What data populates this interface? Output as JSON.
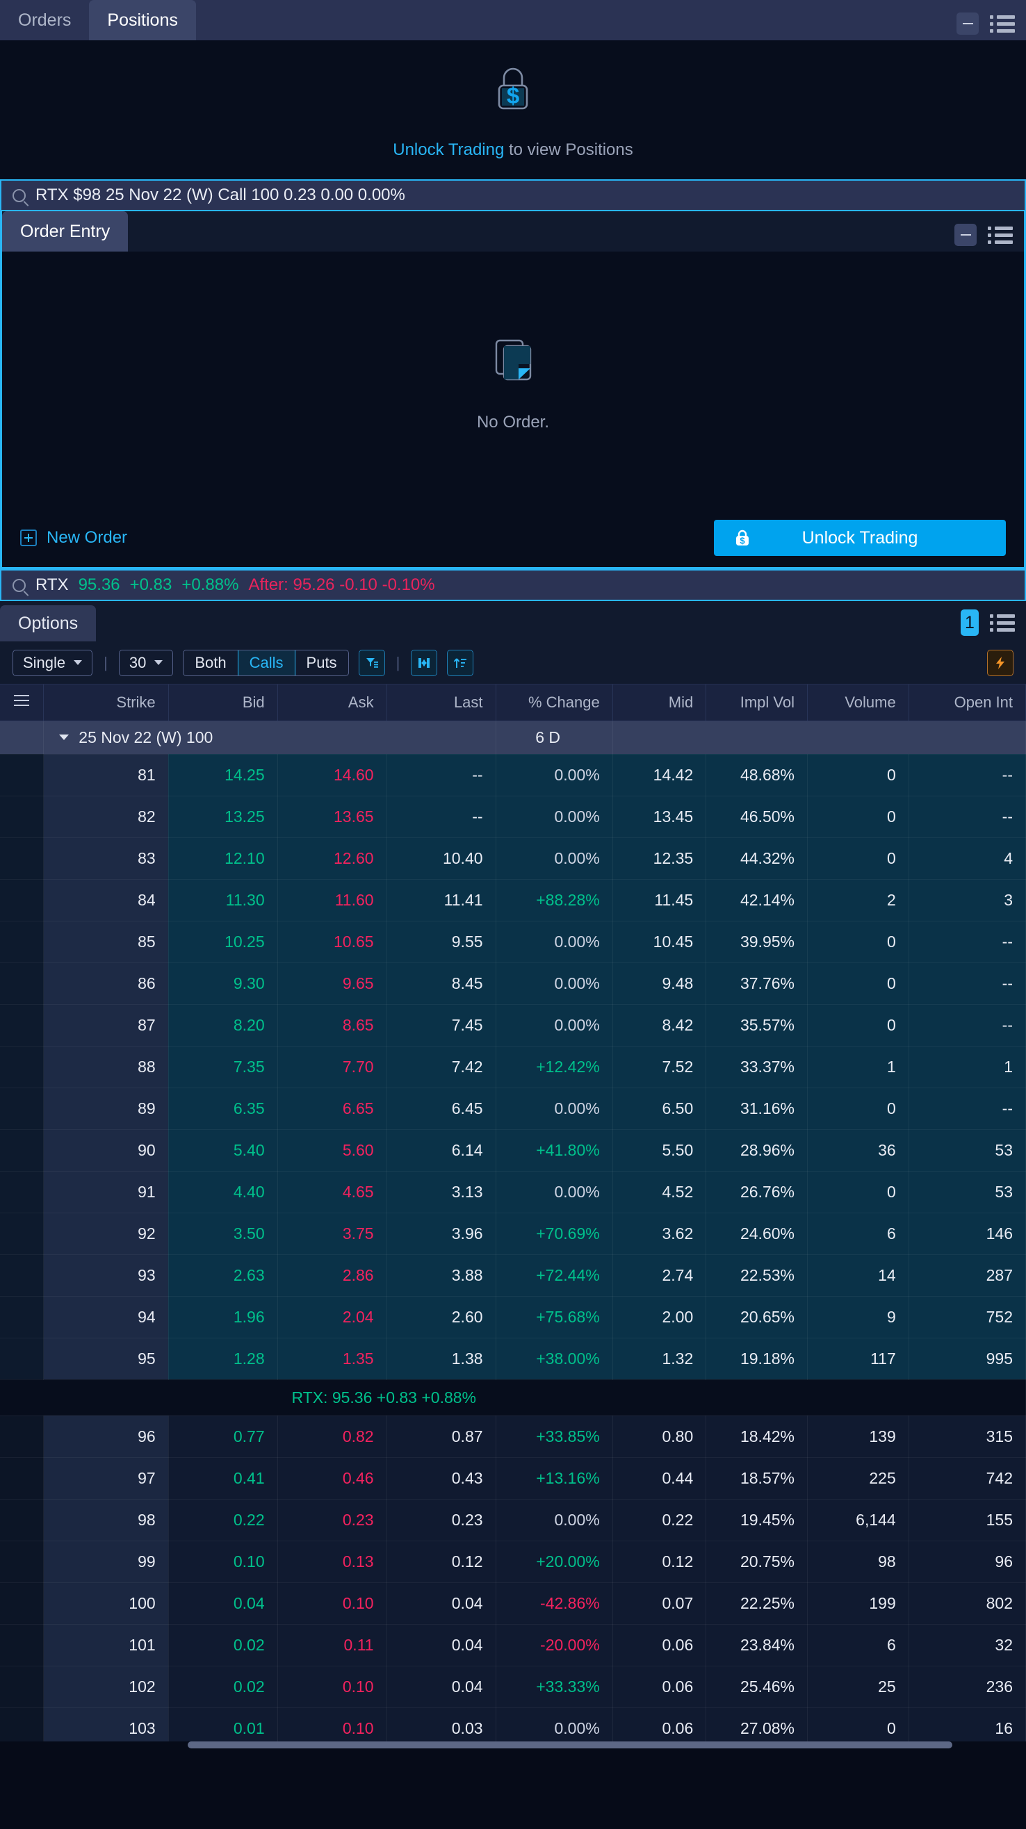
{
  "positions_panel": {
    "tabs": [
      {
        "label": "Orders",
        "active": false
      },
      {
        "label": "Positions",
        "active": true
      }
    ],
    "minimize_label": "",
    "empty": {
      "link_text": "Unlock Trading",
      "rest_text": " to view Positions",
      "icon": "lock-dollar-icon"
    }
  },
  "option_search": {
    "value": "RTX $98 25 Nov 22 (W) Call 100  0.23 0.00 0.00%",
    "icon": "search-icon"
  },
  "order_entry": {
    "tab_label": "Order Entry",
    "empty_text": "No Order.",
    "empty_icon": "documents-icon",
    "new_order_label": "New Order",
    "unlock_label": "Unlock Trading"
  },
  "quote_search": {
    "symbol": "RTX",
    "last": "95.36",
    "change": "+0.83",
    "change_pct": "+0.88%",
    "after_label": "After: 95.26 -0.10 -0.10%"
  },
  "options_panel": {
    "tab_label": "Options",
    "badge": "1",
    "toolbar": {
      "strategy": "Single",
      "count": "30",
      "side_options": [
        {
          "label": "Both",
          "active": false
        },
        {
          "label": "Calls",
          "active": true
        },
        {
          "label": "Puts",
          "active": false
        }
      ],
      "icons": [
        "filter-icon",
        "split-columns-icon",
        "sort-ascending-icon",
        "lightning-icon"
      ]
    },
    "columns": [
      "Strike",
      "Bid",
      "Ask",
      "Last",
      "% Change",
      "Mid",
      "Impl Vol",
      "Volume",
      "Open Int"
    ],
    "menu_icon": "hamburger-icon",
    "expiry_group": {
      "label": "25 Nov 22 (W) 100",
      "days": "6 D"
    },
    "underlying_marker": "RTX: 95.36 +0.83 +0.88%",
    "rows": [
      {
        "strike": "81",
        "bid": "14.25",
        "ask": "14.60",
        "last": "--",
        "change": "0.00%",
        "chg_dir": "flat",
        "mid": "14.42",
        "iv": "48.68%",
        "volume": "0",
        "oi": "--",
        "itm": true
      },
      {
        "strike": "82",
        "bid": "13.25",
        "ask": "13.65",
        "last": "--",
        "change": "0.00%",
        "chg_dir": "flat",
        "mid": "13.45",
        "iv": "46.50%",
        "volume": "0",
        "oi": "--",
        "itm": true
      },
      {
        "strike": "83",
        "bid": "12.10",
        "ask": "12.60",
        "last": "10.40",
        "change": "0.00%",
        "chg_dir": "flat",
        "mid": "12.35",
        "iv": "44.32%",
        "volume": "0",
        "oi": "4",
        "itm": true
      },
      {
        "strike": "84",
        "bid": "11.30",
        "ask": "11.60",
        "last": "11.41",
        "change": "+88.28%",
        "chg_dir": "up",
        "mid": "11.45",
        "iv": "42.14%",
        "volume": "2",
        "oi": "3",
        "itm": true
      },
      {
        "strike": "85",
        "bid": "10.25",
        "ask": "10.65",
        "last": "9.55",
        "change": "0.00%",
        "chg_dir": "flat",
        "mid": "10.45",
        "iv": "39.95%",
        "volume": "0",
        "oi": "--",
        "itm": true
      },
      {
        "strike": "86",
        "bid": "9.30",
        "ask": "9.65",
        "last": "8.45",
        "change": "0.00%",
        "chg_dir": "flat",
        "mid": "9.48",
        "iv": "37.76%",
        "volume": "0",
        "oi": "--",
        "itm": true
      },
      {
        "strike": "87",
        "bid": "8.20",
        "ask": "8.65",
        "last": "7.45",
        "change": "0.00%",
        "chg_dir": "flat",
        "mid": "8.42",
        "iv": "35.57%",
        "volume": "0",
        "oi": "--",
        "itm": true
      },
      {
        "strike": "88",
        "bid": "7.35",
        "ask": "7.70",
        "last": "7.42",
        "change": "+12.42%",
        "chg_dir": "up",
        "mid": "7.52",
        "iv": "33.37%",
        "volume": "1",
        "oi": "1",
        "itm": true
      },
      {
        "strike": "89",
        "bid": "6.35",
        "ask": "6.65",
        "last": "6.45",
        "change": "0.00%",
        "chg_dir": "flat",
        "mid": "6.50",
        "iv": "31.16%",
        "volume": "0",
        "oi": "--",
        "itm": true
      },
      {
        "strike": "90",
        "bid": "5.40",
        "ask": "5.60",
        "last": "6.14",
        "change": "+41.80%",
        "chg_dir": "up",
        "mid": "5.50",
        "iv": "28.96%",
        "volume": "36",
        "oi": "53",
        "itm": true
      },
      {
        "strike": "91",
        "bid": "4.40",
        "ask": "4.65",
        "last": "3.13",
        "change": "0.00%",
        "chg_dir": "flat",
        "mid": "4.52",
        "iv": "26.76%",
        "volume": "0",
        "oi": "53",
        "itm": true
      },
      {
        "strike": "92",
        "bid": "3.50",
        "ask": "3.75",
        "last": "3.96",
        "change": "+70.69%",
        "chg_dir": "up",
        "mid": "3.62",
        "iv": "24.60%",
        "volume": "6",
        "oi": "146",
        "itm": true
      },
      {
        "strike": "93",
        "bid": "2.63",
        "ask": "2.86",
        "last": "3.88",
        "change": "+72.44%",
        "chg_dir": "up",
        "mid": "2.74",
        "iv": "22.53%",
        "volume": "14",
        "oi": "287",
        "itm": true
      },
      {
        "strike": "94",
        "bid": "1.96",
        "ask": "2.04",
        "last": "2.60",
        "change": "+75.68%",
        "chg_dir": "up",
        "mid": "2.00",
        "iv": "20.65%",
        "volume": "9",
        "oi": "752",
        "itm": true
      },
      {
        "strike": "95",
        "bid": "1.28",
        "ask": "1.35",
        "last": "1.38",
        "change": "+38.00%",
        "chg_dir": "up",
        "mid": "1.32",
        "iv": "19.18%",
        "volume": "117",
        "oi": "995",
        "itm": true
      },
      {
        "strike": "96",
        "bid": "0.77",
        "ask": "0.82",
        "last": "0.87",
        "change": "+33.85%",
        "chg_dir": "up",
        "mid": "0.80",
        "iv": "18.42%",
        "volume": "139",
        "oi": "315",
        "itm": false
      },
      {
        "strike": "97",
        "bid": "0.41",
        "ask": "0.46",
        "last": "0.43",
        "change": "+13.16%",
        "chg_dir": "up",
        "mid": "0.44",
        "iv": "18.57%",
        "volume": "225",
        "oi": "742",
        "itm": false
      },
      {
        "strike": "98",
        "bid": "0.22",
        "ask": "0.23",
        "last": "0.23",
        "change": "0.00%",
        "chg_dir": "flat",
        "mid": "0.22",
        "iv": "19.45%",
        "volume": "6,144",
        "oi": "155",
        "itm": false
      },
      {
        "strike": "99",
        "bid": "0.10",
        "ask": "0.13",
        "last": "0.12",
        "change": "+20.00%",
        "chg_dir": "up",
        "mid": "0.12",
        "iv": "20.75%",
        "volume": "98",
        "oi": "96",
        "itm": false
      },
      {
        "strike": "100",
        "bid": "0.04",
        "ask": "0.10",
        "last": "0.04",
        "change": "-42.86%",
        "chg_dir": "down",
        "mid": "0.07",
        "iv": "22.25%",
        "volume": "199",
        "oi": "802",
        "itm": false
      },
      {
        "strike": "101",
        "bid": "0.02",
        "ask": "0.11",
        "last": "0.04",
        "change": "-20.00%",
        "chg_dir": "down",
        "mid": "0.06",
        "iv": "23.84%",
        "volume": "6",
        "oi": "32",
        "itm": false
      },
      {
        "strike": "102",
        "bid": "0.02",
        "ask": "0.10",
        "last": "0.04",
        "change": "+33.33%",
        "chg_dir": "up",
        "mid": "0.06",
        "iv": "25.46%",
        "volume": "25",
        "oi": "236",
        "itm": false
      },
      {
        "strike": "103",
        "bid": "0.01",
        "ask": "0.10",
        "last": "0.03",
        "change": "0.00%",
        "chg_dir": "flat",
        "mid": "0.06",
        "iv": "27.08%",
        "volume": "0",
        "oi": "16",
        "itm": false
      }
    ]
  },
  "colors": {
    "accent": "#29b6f6",
    "up": "#00c08b",
    "down": "#f3225e",
    "itm_row": "#0b3a52"
  }
}
